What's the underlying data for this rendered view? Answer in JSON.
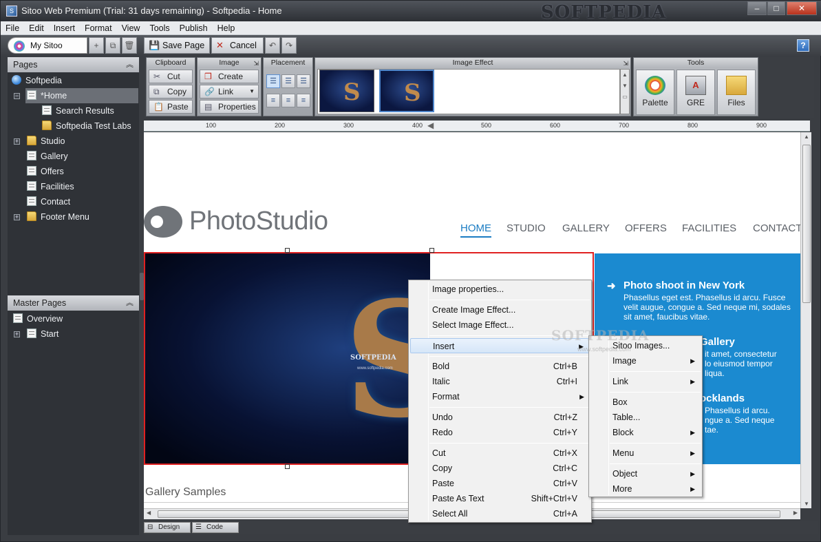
{
  "window": {
    "title": "Sitoo Web Premium (Trial: 31 days remaining) - Softpedia - Home",
    "watermark": "SOFTPEDIA",
    "controls": {
      "minimize": "–",
      "maximize": "□",
      "close": "✕"
    }
  },
  "menubar": [
    "File",
    "Edit",
    "Insert",
    "Format",
    "View",
    "Tools",
    "Publish",
    "Help"
  ],
  "toolbar": {
    "my_sitoo": "My Sitoo",
    "save_page": "Save Page",
    "cancel": "Cancel",
    "help": "?"
  },
  "pages_panel": {
    "title": "Pages",
    "root": "Softpedia",
    "items": [
      {
        "label": "*Home",
        "type": "page",
        "selected": true
      },
      {
        "label": "Search Results",
        "type": "page"
      },
      {
        "label": "Softpedia Test Labs",
        "type": "folder"
      },
      {
        "label": "Studio",
        "type": "folder"
      },
      {
        "label": "Gallery",
        "type": "page"
      },
      {
        "label": "Offers",
        "type": "page"
      },
      {
        "label": "Facilities",
        "type": "page"
      },
      {
        "label": "Contact",
        "type": "page"
      },
      {
        "label": "Footer Menu",
        "type": "folder"
      }
    ]
  },
  "master_pages_panel": {
    "title": "Master Pages",
    "items": [
      {
        "label": "Overview"
      },
      {
        "label": "Start"
      }
    ]
  },
  "ribbon": {
    "clipboard": {
      "title": "Clipboard",
      "cut": "Cut",
      "copy": "Copy",
      "paste": "Paste"
    },
    "image": {
      "title": "Image",
      "create": "Create",
      "link": "Link",
      "properties": "Properties"
    },
    "placement": {
      "title": "Placement"
    },
    "image_effect": {
      "title": "Image Effect"
    },
    "tools": {
      "title": "Tools",
      "palette": "Palette",
      "gre": "GRE",
      "files": "Files"
    }
  },
  "ruler": [
    "100",
    "200",
    "300",
    "400",
    "500",
    "600",
    "700",
    "800",
    "900"
  ],
  "page": {
    "logo": "PhotoStudio",
    "nav": [
      "HOME",
      "STUDIO",
      "GALLERY",
      "OFFERS",
      "FACILITIES",
      "CONTACT"
    ],
    "hero_watermark": "SOFTPEDIA",
    "hero_url": "www.softpedia.com",
    "blue_panel": {
      "h1": "Photo shoot in New York",
      "p1": "Phasellus eget est. Phasellus id arcu. Fusce velit augue, congue a. Sed neque mi, sodales sit amet, faucibus vitae.",
      "h2": "Gallery",
      "p2": "it amet, consectetur lo eiusmod tempor liqua.",
      "h3": "ocklands",
      "p3": "Phasellus id arcu. ngue a. Sed neque tae."
    },
    "gallery_title": "Gallery Samples"
  },
  "context_menu": [
    {
      "label": "Image properties...",
      "shortcut": ""
    },
    {
      "label": "Create Image Effect...",
      "shortcut": ""
    },
    {
      "label": "Select Image Effect...",
      "shortcut": ""
    },
    {
      "label": "Insert",
      "submenu": true
    },
    {
      "label": "Bold",
      "shortcut": "Ctrl+B"
    },
    {
      "label": "Italic",
      "shortcut": "Ctrl+I"
    },
    {
      "label": "Format",
      "submenu": true
    },
    {
      "label": "Undo",
      "shortcut": "Ctrl+Z"
    },
    {
      "label": "Redo",
      "shortcut": "Ctrl+Y"
    },
    {
      "label": "Cut",
      "shortcut": "Ctrl+X"
    },
    {
      "label": "Copy",
      "shortcut": "Ctrl+C"
    },
    {
      "label": "Paste",
      "shortcut": "Ctrl+V"
    },
    {
      "label": "Paste As Text",
      "shortcut": "Shift+Ctrl+V"
    },
    {
      "label": "Select All",
      "shortcut": "Ctrl+A"
    }
  ],
  "insert_submenu": [
    {
      "label": "Sitoo Images..."
    },
    {
      "label": "Image",
      "submenu": true
    },
    {
      "label": "Link",
      "submenu": true
    },
    {
      "label": "Box"
    },
    {
      "label": "Table..."
    },
    {
      "label": "Block",
      "submenu": true
    },
    {
      "label": "Menu",
      "submenu": true
    },
    {
      "label": "Object",
      "submenu": true
    },
    {
      "label": "More",
      "submenu": true
    }
  ],
  "overlay_watermark": "SOFTPEDIA",
  "overlay_watermark_url": "www.softpedia.com",
  "bottom_tabs": {
    "design": "Design",
    "code": "Code"
  },
  "colors": {
    "accent": "#1a7cc3",
    "selection": "#e02020",
    "blue_panel": "#1b8ad0"
  }
}
